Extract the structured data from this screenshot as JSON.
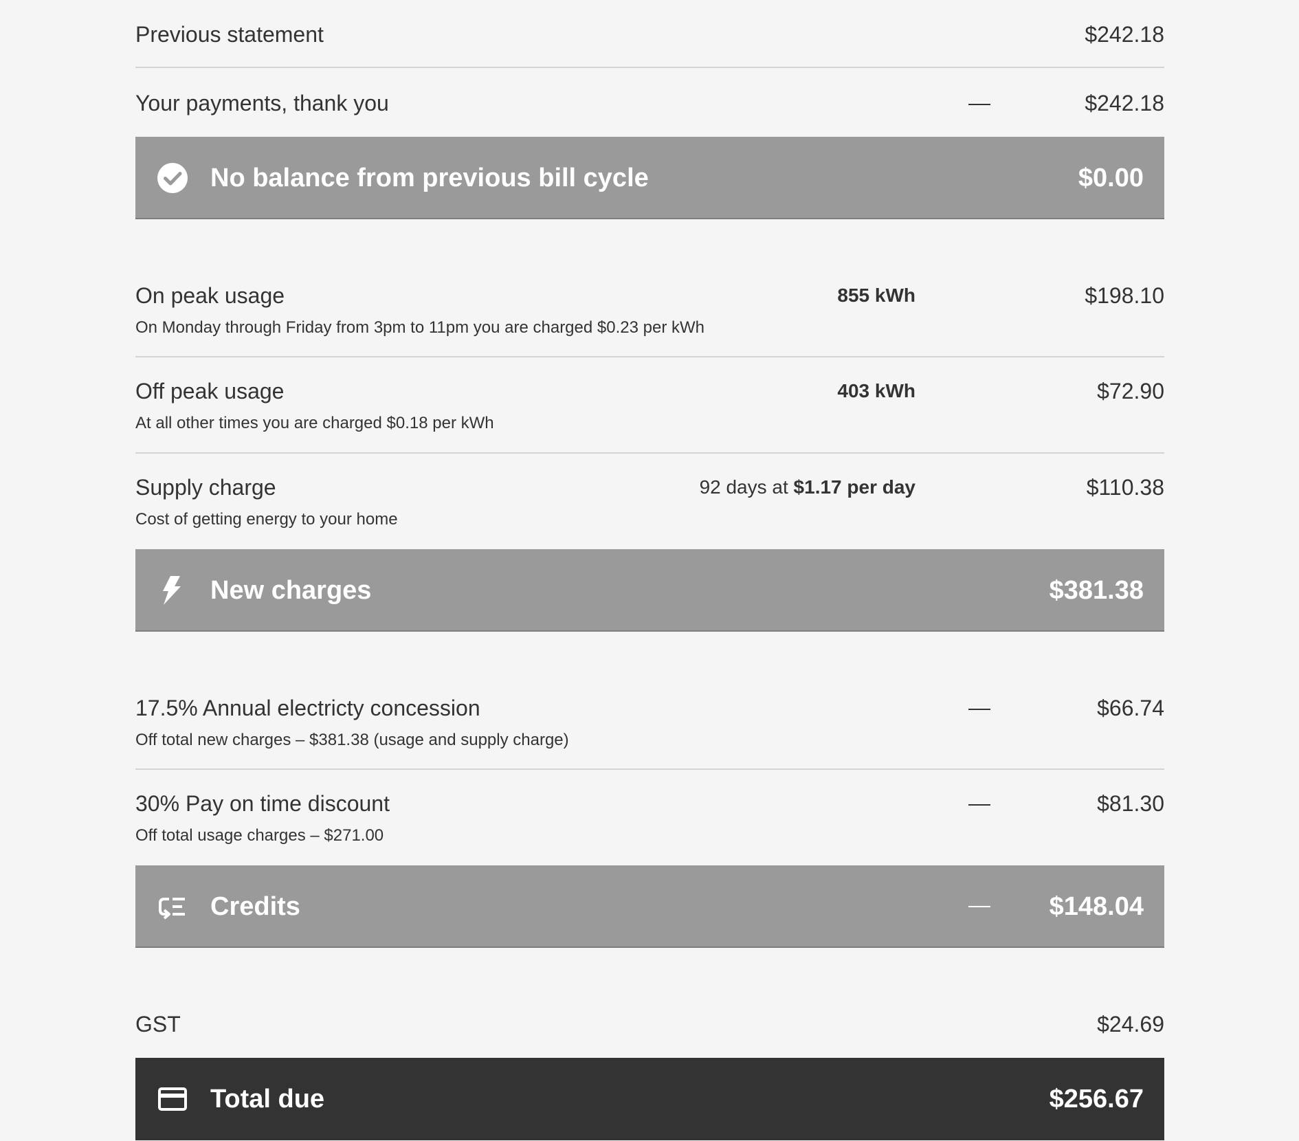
{
  "previous": {
    "statement_label": "Previous statement",
    "statement_amount": "$242.18",
    "payments_label": "Your payments, thank you",
    "payments_amount": "$242.18",
    "balance_label": "No balance from previous bill cycle",
    "balance_amount": "$0.00",
    "balance_icon": "check-circle-icon"
  },
  "charges": {
    "on_peak": {
      "label": "On peak usage",
      "detail": "On Monday through Friday from 3pm to 11pm you are charged $0.23 per kWh",
      "quantity": "855 kWh",
      "amount": "$198.10"
    },
    "off_peak": {
      "label": "Off peak usage",
      "detail": "At all other times you are charged $0.18 per kWh",
      "quantity": "403 kWh",
      "amount": "$72.90"
    },
    "supply": {
      "label": "Supply charge",
      "detail": "Cost of getting energy to your home",
      "days_text": "92 days at ",
      "rate_text": "$1.17 per day",
      "amount": "$110.38"
    },
    "total_label": "New charges",
    "total_amount": "$381.38",
    "total_icon": "lightning-icon"
  },
  "credits": {
    "concession": {
      "label": "17.5% Annual electricty concession",
      "detail": "Off total new charges – $381.38 (usage and supply charge)",
      "amount": "$66.74"
    },
    "discount": {
      "label": "30% Pay on time discount",
      "detail": "Off total usage charges – $271.00",
      "amount": "$81.30"
    },
    "total_label": "Credits",
    "total_amount": "$148.04",
    "total_icon": "credits-list-icon"
  },
  "tax": {
    "label": "GST",
    "amount": "$24.69"
  },
  "total_due": {
    "label": "Total due",
    "amount": "$256.67",
    "icon": "credit-card-icon"
  },
  "colors": {
    "background": "#f5f5f5",
    "text": "#333333",
    "band": "#9a9a9a",
    "total_band": "#333333",
    "band_text": "#ffffff",
    "divider": "#d4d4d4"
  }
}
